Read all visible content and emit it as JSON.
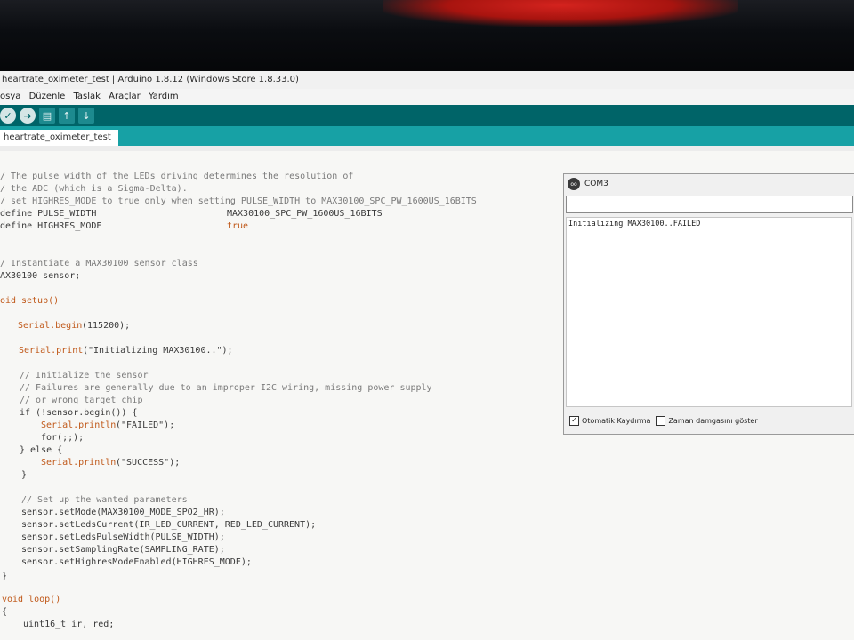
{
  "window": {
    "title": "heartrate_oximeter_test | Arduino 1.8.12 (Windows Store 1.8.33.0)"
  },
  "menu": [
    "osya",
    "Düzenle",
    "Taslak",
    "Araçlar",
    "Yardım"
  ],
  "toolbar": {
    "verify_icon": "check-icon",
    "upload_icon": "arrow-right-icon",
    "new_icon": "new-file-icon",
    "open_icon": "arrow-up-icon",
    "save_icon": "arrow-down-icon"
  },
  "tab": {
    "label": "heartrate_oximeter_test"
  },
  "code": {
    "l01": "/ The pulse width of the LEDs driving determines the resolution of",
    "l02": "/ the ADC (which is a Sigma-Delta).",
    "l03": "/ set HIGHRES_MODE to true only when setting PULSE_WIDTH to MAX30100_SPC_PW_1600US_16BITS",
    "l04a": "define PULSE_WIDTH",
    "l04b": "MAX30100_SPC_PW_1600US_16BITS",
    "l05a": "define HIGHRES_MODE",
    "l05b": "true",
    "l06": "/ Instantiate a MAX30100 sensor class",
    "l07": "AX30100 sensor;",
    "l08a": "oid",
    "l08b": "setup()",
    "l09a": "Serial.begin",
    "l09b": "(115200);",
    "l10a": "Serial.print",
    "l10b": "(\"Initializing MAX30100..\");",
    "l11": "// Initialize the sensor",
    "l12": "// Failures are generally due to an improper I2C wiring, missing power supply",
    "l13": "// or wrong target chip",
    "l14": "if (!sensor.begin()) {",
    "l15a": "Serial.println",
    "l15b": "(\"FAILED\");",
    "l16": "for(;;);",
    "l17": "} else {",
    "l18a": "Serial.println",
    "l18b": "(\"SUCCESS\");",
    "l19": "}",
    "l20": "// Set up the wanted parameters",
    "l21": "sensor.setMode(MAX30100_MODE_SPO2_HR);",
    "l22": "sensor.setLedsCurrent(IR_LED_CURRENT, RED_LED_CURRENT);",
    "l23": "sensor.setLedsPulseWidth(PULSE_WIDTH);",
    "l24": "sensor.setSamplingRate(SAMPLING_RATE);",
    "l25": "sensor.setHighresModeEnabled(HIGHRES_MODE);",
    "l26": "}",
    "l27": "void loop()",
    "l28": "{",
    "l29": "uint16_t ir, red;"
  },
  "serial_monitor": {
    "title": "COM3",
    "icon_text": "oo",
    "output": "Initializing MAX30100..FAILED",
    "autoscroll_label": "Otomatik Kaydırma",
    "autoscroll_checked": "✓",
    "timestamp_label": "Zaman damgasını göster"
  }
}
